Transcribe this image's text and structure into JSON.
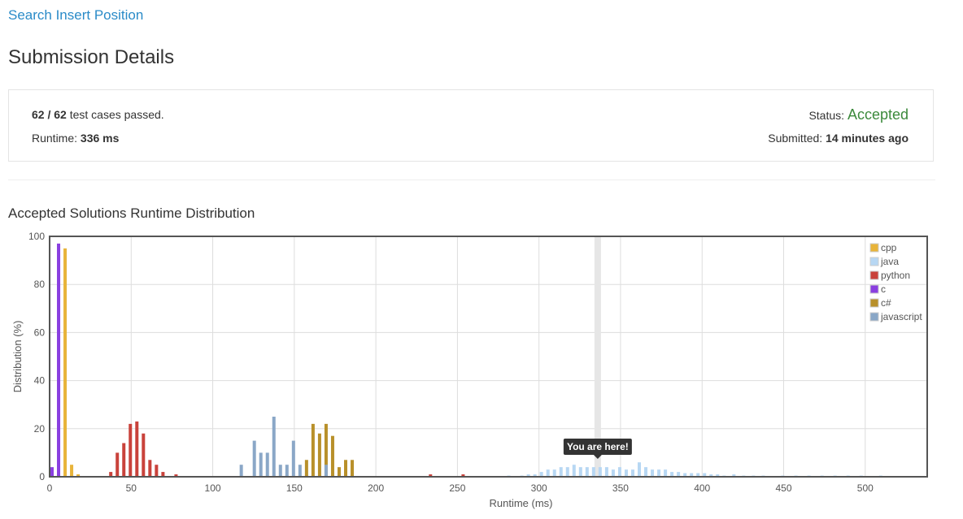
{
  "problem": {
    "title": "Search Insert Position"
  },
  "page": {
    "title": "Submission Details"
  },
  "details": {
    "passed": "62",
    "total": "62",
    "passed_suffix": "test cases passed.",
    "runtime_label": "Runtime:",
    "runtime_value": "336 ms",
    "status_label": "Status:",
    "status_value": "Accepted",
    "status_color": "#3c8a3c",
    "submitted_label": "Submitted:",
    "submitted_value": "14 minutes ago"
  },
  "distribution": {
    "title": "Accepted Solutions Runtime Distribution"
  },
  "chart_data": {
    "type": "bar",
    "xlabel": "Runtime (ms)",
    "ylabel": "Distribution (%)",
    "xlim": [
      0,
      538
    ],
    "ylim": [
      0,
      100
    ],
    "xticks": [
      0,
      50,
      100,
      150,
      200,
      250,
      300,
      350,
      400,
      450,
      500
    ],
    "yticks": [
      0,
      20,
      40,
      60,
      80,
      100
    ],
    "grid": true,
    "legend_position": "top-right",
    "highlight": {
      "x": 336,
      "label": "You are here!"
    },
    "series": [
      {
        "name": "cpp",
        "color": "#e8b43a",
        "x": [
          8,
          12,
          16
        ],
        "values": [
          95,
          5,
          1
        ]
      },
      {
        "name": "java",
        "color": "#b7d7f3",
        "x": [
          280,
          288,
          292,
          296,
          300,
          304,
          308,
          312,
          316,
          320,
          324,
          328,
          332,
          336,
          340,
          344,
          348,
          352,
          356,
          360,
          364,
          368,
          372,
          376,
          380,
          384,
          388,
          392,
          396,
          400,
          404,
          408,
          412,
          418,
          424,
          430,
          436,
          448,
          456,
          464,
          472,
          480,
          488,
          496,
          508
        ],
        "values": [
          0.5,
          0.5,
          1,
          1,
          2,
          3,
          3,
          4,
          4,
          5,
          4,
          4,
          4,
          4,
          4,
          3,
          4,
          3,
          3,
          6,
          4,
          3,
          3,
          3,
          2,
          2,
          1.5,
          1.5,
          1.5,
          1.5,
          1,
          1,
          0.5,
          1,
          0.5,
          0.5,
          0.5,
          0.5,
          0.5,
          0.5,
          0.5,
          0.5,
          0.5,
          0.5,
          0.5
        ]
      },
      {
        "name": "python",
        "color": "#c9423b",
        "x": [
          36,
          40,
          44,
          48,
          52,
          56,
          60,
          64,
          68,
          76,
          232,
          252
        ],
        "values": [
          2,
          10,
          14,
          22,
          23,
          18,
          7,
          5,
          2,
          1,
          1,
          1
        ]
      },
      {
        "name": "c",
        "color": "#8a3fe0",
        "x": [
          0,
          4
        ],
        "values": [
          4,
          97
        ]
      },
      {
        "name": "c#",
        "color": "#b8902a",
        "x": [
          156,
          160,
          164,
          168,
          172,
          176,
          180,
          184
        ],
        "values": [
          7,
          22,
          18,
          22,
          17,
          4,
          7,
          7
        ]
      },
      {
        "name": "javascript",
        "color": "#8aa7c7",
        "x": [
          116,
          124,
          128,
          132,
          136,
          140,
          144,
          148,
          152,
          168
        ],
        "values": [
          5,
          15,
          10,
          10,
          25,
          5,
          5,
          15,
          5,
          5
        ]
      }
    ]
  }
}
